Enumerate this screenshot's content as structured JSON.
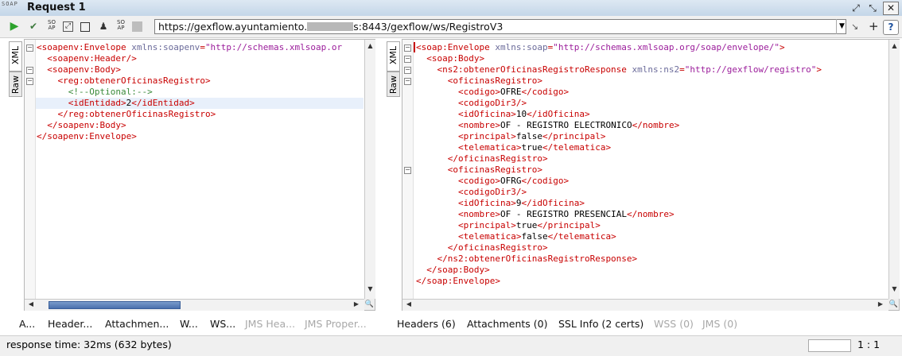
{
  "window": {
    "logo_text": "SOAP",
    "title": "Request 1"
  },
  "toolbar": {
    "icons": [
      "run-icon",
      "check-icon",
      "soap-ws-icon",
      "expand-icon",
      "stop-icon",
      "user-icon",
      "soap-wsa-icon",
      "grey-square-icon"
    ],
    "url": "https://gexflow.ayuntamiento.",
    "url_suffix": "s:8443/gexflow/ws/RegistroV3"
  },
  "request_pane": {
    "side_tabs": [
      "XML",
      "Raw"
    ],
    "lines": [
      {
        "indent": 0,
        "fold": "minus",
        "parts": [
          [
            "t",
            "<soapenv:Envelope"
          ],
          [
            "a",
            " xmlns:soapenv"
          ],
          [
            "t",
            "="
          ],
          [
            "v",
            "\"http://schemas.xmlsoap.or"
          ]
        ]
      },
      {
        "indent": 2,
        "fold": "",
        "parts": [
          [
            "t",
            "<soapenv:Header/>"
          ]
        ]
      },
      {
        "indent": 2,
        "fold": "minus",
        "parts": [
          [
            "t",
            "<soapenv:Body>"
          ]
        ]
      },
      {
        "indent": 4,
        "fold": "minus",
        "parts": [
          [
            "t",
            "<reg:obtenerOficinasRegistro>"
          ]
        ]
      },
      {
        "indent": 6,
        "fold": "",
        "parts": [
          [
            "c",
            "<!--Optional:-->"
          ]
        ]
      },
      {
        "indent": 6,
        "fold": "",
        "parts": [
          [
            "t",
            "<idEntidad>"
          ],
          [
            "x",
            "2"
          ],
          [
            "t",
            "</idEntidad>"
          ]
        ]
      },
      {
        "indent": 4,
        "fold": "",
        "parts": [
          [
            "t",
            "</reg:obtenerOficinasRegistro>"
          ]
        ]
      },
      {
        "indent": 2,
        "fold": "",
        "parts": [
          [
            "t",
            "</soapenv:Body>"
          ]
        ]
      },
      {
        "indent": 0,
        "fold": "",
        "parts": [
          [
            "t",
            "</soapenv:Envelope>"
          ]
        ]
      }
    ],
    "tabs": [
      "A...",
      "Header...",
      "Attachmen...",
      "W...",
      "WS...",
      "JMS Hea...",
      "JMS Proper..."
    ]
  },
  "response_pane": {
    "side_tabs": [
      "XML",
      "Raw"
    ],
    "lines": [
      {
        "indent": 0,
        "fold": "minus",
        "parts": [
          [
            "t",
            "<soap:Envelope"
          ],
          [
            "a",
            " xmlns:soap"
          ],
          [
            "t",
            "="
          ],
          [
            "v",
            "\"http://schemas.xmlsoap.org/soap/envelope/\""
          ],
          [
            "t",
            ">"
          ]
        ]
      },
      {
        "indent": 2,
        "fold": "minus",
        "parts": [
          [
            "t",
            "<soap:Body>"
          ]
        ]
      },
      {
        "indent": 4,
        "fold": "minus",
        "parts": [
          [
            "t",
            "<ns2:obtenerOficinasRegistroResponse"
          ],
          [
            "a",
            " xmlns:ns2"
          ],
          [
            "t",
            "="
          ],
          [
            "v",
            "\"http://gexflow/registro\""
          ],
          [
            "t",
            ">"
          ]
        ]
      },
      {
        "indent": 6,
        "fold": "minus",
        "parts": [
          [
            "t",
            "<oficinasRegistro>"
          ]
        ]
      },
      {
        "indent": 8,
        "fold": "",
        "parts": [
          [
            "t",
            "<codigo>"
          ],
          [
            "x",
            "OFRE"
          ],
          [
            "t",
            "</codigo>"
          ]
        ]
      },
      {
        "indent": 8,
        "fold": "",
        "parts": [
          [
            "t",
            "<codigoDir3/>"
          ]
        ]
      },
      {
        "indent": 8,
        "fold": "",
        "parts": [
          [
            "t",
            "<idOficina>"
          ],
          [
            "x",
            "10"
          ],
          [
            "t",
            "</idOficina>"
          ]
        ]
      },
      {
        "indent": 8,
        "fold": "",
        "parts": [
          [
            "t",
            "<nombre>"
          ],
          [
            "x",
            "OF - REGISTRO ELECTRONICO"
          ],
          [
            "t",
            "</nombre>"
          ]
        ]
      },
      {
        "indent": 8,
        "fold": "",
        "parts": [
          [
            "t",
            "<principal>"
          ],
          [
            "x",
            "false"
          ],
          [
            "t",
            "</principal>"
          ]
        ]
      },
      {
        "indent": 8,
        "fold": "",
        "parts": [
          [
            "t",
            "<telematica>"
          ],
          [
            "x",
            "true"
          ],
          [
            "t",
            "</telematica>"
          ]
        ]
      },
      {
        "indent": 6,
        "fold": "",
        "parts": [
          [
            "t",
            "</oficinasRegistro>"
          ]
        ]
      },
      {
        "indent": 6,
        "fold": "minus",
        "parts": [
          [
            "t",
            "<oficinasRegistro>"
          ]
        ]
      },
      {
        "indent": 8,
        "fold": "",
        "parts": [
          [
            "t",
            "<codigo>"
          ],
          [
            "x",
            "OFRG"
          ],
          [
            "t",
            "</codigo>"
          ]
        ]
      },
      {
        "indent": 8,
        "fold": "",
        "parts": [
          [
            "t",
            "<codigoDir3/>"
          ]
        ]
      },
      {
        "indent": 8,
        "fold": "",
        "parts": [
          [
            "t",
            "<idOficina>"
          ],
          [
            "x",
            "9"
          ],
          [
            "t",
            "</idOficina>"
          ]
        ]
      },
      {
        "indent": 8,
        "fold": "",
        "parts": [
          [
            "t",
            "<nombre>"
          ],
          [
            "x",
            "OF - REGISTRO PRESENCIAL"
          ],
          [
            "t",
            "</nombre>"
          ]
        ]
      },
      {
        "indent": 8,
        "fold": "",
        "parts": [
          [
            "t",
            "<principal>"
          ],
          [
            "x",
            "true"
          ],
          [
            "t",
            "</principal>"
          ]
        ]
      },
      {
        "indent": 8,
        "fold": "",
        "parts": [
          [
            "t",
            "<telematica>"
          ],
          [
            "x",
            "false"
          ],
          [
            "t",
            "</telematica>"
          ]
        ]
      },
      {
        "indent": 6,
        "fold": "",
        "parts": [
          [
            "t",
            "</oficinasRegistro>"
          ]
        ]
      },
      {
        "indent": 4,
        "fold": "",
        "parts": [
          [
            "t",
            "</ns2:obtenerOficinasRegistroResponse>"
          ]
        ]
      },
      {
        "indent": 2,
        "fold": "",
        "parts": [
          [
            "t",
            "</soap:Body>"
          ]
        ]
      },
      {
        "indent": 0,
        "fold": "",
        "parts": [
          [
            "t",
            "</soap:Envelope>"
          ]
        ]
      }
    ],
    "tabs": [
      "Headers (6)",
      "Attachments (0)",
      "SSL Info (2 certs)",
      "WSS (0)",
      "JMS (0)"
    ]
  },
  "status": {
    "response_time": "response time: 32ms (632 bytes)",
    "position": "1 : 1"
  },
  "colors": {
    "tag": "#c80000",
    "attr": "#6b6b9a",
    "value": "#9b1d9b",
    "comment": "#3a8a3a",
    "scroll_thumb": "#5a7fb8"
  }
}
